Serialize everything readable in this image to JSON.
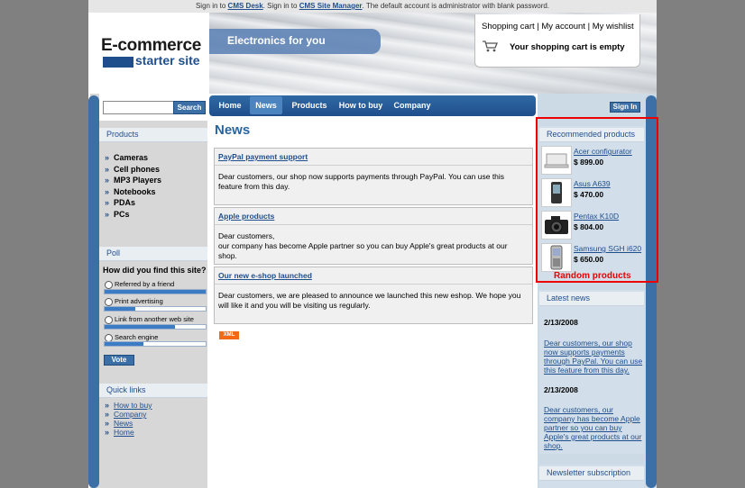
{
  "notice": {
    "part1": "Sign in to",
    "link1": "CMS Desk",
    "part2": ". Sign in to",
    "link2": "CMS Site Manager",
    "part3": ". The default account is administrator with blank password."
  },
  "header": {
    "logo_line1": "E-commerce",
    "logo_line2": "starter site",
    "slogan": "Electronics for you",
    "cart_links": [
      "Shopping cart",
      "My account",
      "My wishlist"
    ],
    "cart_status": "Your shopping cart is empty"
  },
  "search": {
    "value": "",
    "button": "Search"
  },
  "nav": [
    "Home",
    "News",
    "Products",
    "How to buy",
    "Company"
  ],
  "nav_active": "News",
  "sidebar": {
    "products_title": "Products",
    "products": [
      "Cameras",
      "Cell phones",
      "MP3 Players",
      "Notebooks",
      "PDAs",
      "PCs"
    ],
    "poll_title": "Poll",
    "poll_question": "How did you find this site?",
    "poll_options": [
      {
        "label": "Referred by a friend",
        "share": 1.0
      },
      {
        "label": "Print advertising",
        "share": 0.3
      },
      {
        "label": "Link from another web site",
        "share": 0.7
      },
      {
        "label": "Search engine",
        "share": 0.38
      }
    ],
    "vote_button": "Vote",
    "quicklinks_title": "Quick links",
    "quicklinks": [
      "How to buy",
      "Company",
      "News",
      "Home"
    ]
  },
  "main": {
    "title": "News",
    "news": [
      {
        "title": "PayPal payment support",
        "body": "Dear customers, our shop now supports payments through PayPal. You can use this feature from this day."
      },
      {
        "title": "Apple products",
        "body_line1": "Dear customers,",
        "body_line2": "our company has become Apple partner so you can buy Apple's great products at our shop."
      },
      {
        "title": "Our new e-shop launched",
        "body": "Dear customers, we are pleased to announce we launched this new eshop. We hope you will like it and you will be visiting us regularly."
      }
    ],
    "xml_badge": "XML"
  },
  "right": {
    "signin": "Sign In",
    "recommended_title": "Recommended products",
    "recommended": [
      {
        "name": "Acer configurator",
        "price": "$ 899.00",
        "icon": "laptop-icon"
      },
      {
        "name": "Asus A639",
        "price": "$ 470.00",
        "icon": "pda-icon"
      },
      {
        "name": "Pentax K10D",
        "price": "$ 804.00",
        "icon": "camera-icon"
      },
      {
        "name": "Samsung SGH i620",
        "price": "$ 650.00",
        "icon": "phone-icon"
      }
    ],
    "random_label": "Random products",
    "latest_title": "Latest news",
    "latest": [
      {
        "date": "2/13/2008",
        "text": "Dear customers, our shop now supports payments through PayPal. You can use this feature from this day."
      },
      {
        "date": "2/13/2008",
        "text": "Dear customers, our company has become Apple partner so you can buy Apple's great products at our shop."
      }
    ],
    "newsletter_title": "Newsletter subscription"
  },
  "colors": {
    "brand": "#1f4e8c",
    "accent": "#3b6fa6",
    "highlight": "#ee0000"
  }
}
